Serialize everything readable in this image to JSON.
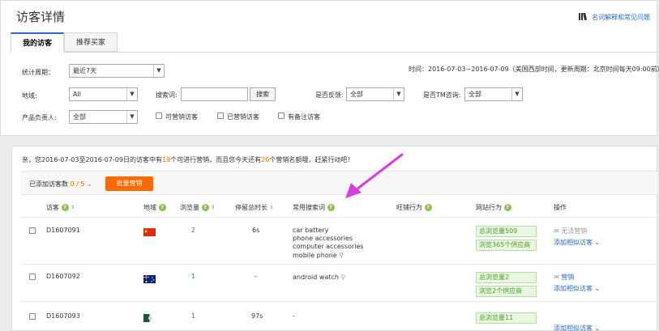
{
  "page": {
    "title": "访客详情",
    "help_link": "名词解释和常见问题"
  },
  "tabs": [
    {
      "label": "我的访客",
      "active": true
    },
    {
      "label": "推荐买家",
      "active": false
    }
  ],
  "filters": {
    "period_label": "统计周期：",
    "period_value": "最近7天",
    "time_info": "时间：2016-07-03~2016-07-09（美国西部时间，更新周期：北京时间每天09:00前）",
    "region_label": "地域:",
    "region_value": "All",
    "search_label": "搜索词:",
    "search_value": "",
    "search_button": "搜索",
    "feedback_label": "是否反馈:",
    "feedback_value": "全部",
    "tm_label": "是否TM咨询:",
    "tm_value": "全部",
    "owner_label": "产品负责人:",
    "owner_value": "全部",
    "check_marketable": "可营销访客",
    "check_marketed": "已营销访客",
    "check_noted": "有备注访客"
  },
  "notice": {
    "part1": "亲，您2016-07-03至2016-07-09日的访客中有",
    "count1": "19",
    "part2": "个可进行营销，而且您今天还有",
    "count2": "20",
    "part3": "个营销名额哦，赶紧行动吧！"
  },
  "toolbar": {
    "added_label": "已添加访客数",
    "added_count": "0 / 5",
    "batch_button": "批量营销"
  },
  "columns": {
    "visitor": "访客",
    "region": "地域",
    "views": "浏览量",
    "duration": "停留总时长",
    "keywords": "常用搜索词",
    "wangwang": "旺铺行为",
    "site": "网站行为",
    "action": "操作"
  },
  "rows": [
    {
      "id": "D1607091",
      "flag": "china-flag",
      "views": "2",
      "duration": "6s",
      "keywords": [
        "car battery",
        "phone accessories",
        "computer accessories",
        "mobile phone"
      ],
      "site_tags": [
        "总浏览量509",
        "浏览365个供应商"
      ],
      "action1": "无法营销",
      "action2": "添加相似访客"
    },
    {
      "id": "D1607092",
      "flag": "australia-flag",
      "views": "1",
      "duration": "-",
      "keywords": [
        "android watch"
      ],
      "site_tags": [
        "总浏览量2",
        "浏览2个供应商"
      ],
      "action1": "营销",
      "action2": "添加相似访客"
    },
    {
      "id": "D1607093",
      "flag": "algeria-flag",
      "views": "1",
      "duration": "97s",
      "keywords": [
        "-"
      ],
      "site_tags": [
        "总浏览量11"
      ],
      "action1": "",
      "action2": "添加相似访客"
    }
  ],
  "colors": {
    "accent": "#2a6ebb",
    "orange": "#ff6a00",
    "green": "#8cc152",
    "arrow": "#d63ee0"
  }
}
